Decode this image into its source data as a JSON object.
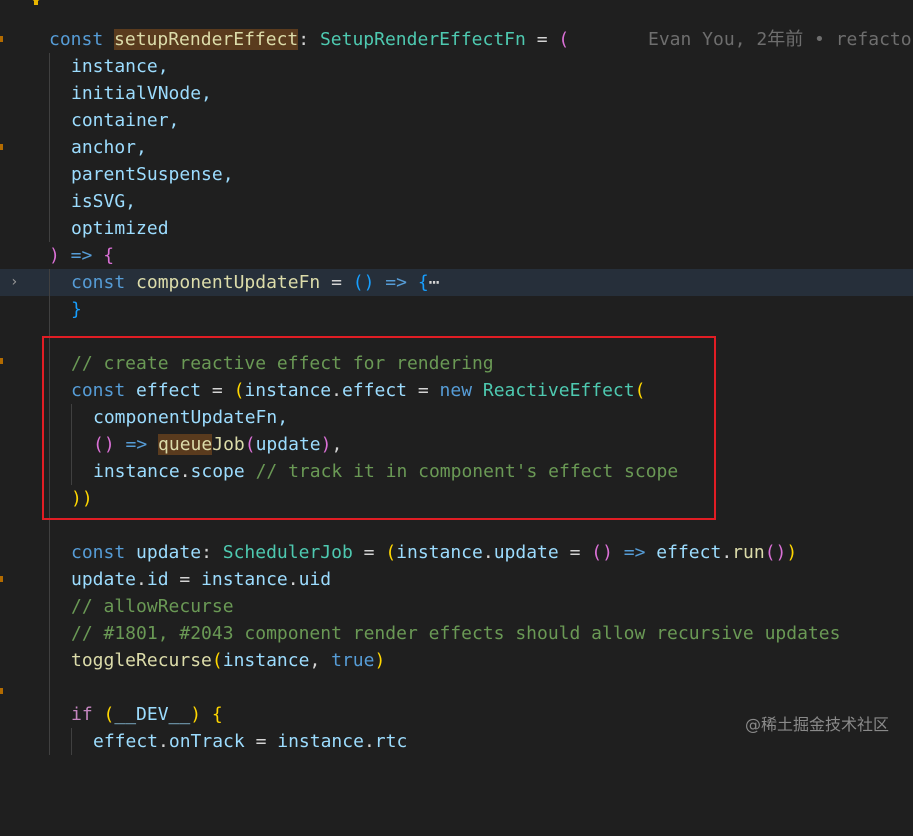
{
  "blame": "Evan You, 2年前 • refacto",
  "watermark": "@稀土掘金技术社区",
  "code": {
    "l1_const": "const",
    "l1_name": "setupRenderEffect",
    "l1_colon": ": ",
    "l1_type": "SetupRenderEffectFn",
    "l1_eq": " = ",
    "l1_paren": "(",
    "p_instance": "instance,",
    "p_initialVNode": "initialVNode,",
    "p_container": "container,",
    "p_anchor": "anchor,",
    "p_parentSuspense": "parentSuspense,",
    "p_isSVG": "isSVG,",
    "p_optimized": "optimized",
    "close_paren": ")",
    "arrow_open": " => ",
    "brace_open": "{",
    "cu_const": "const",
    "cu_name": "componentUpdateFn",
    "cu_eq": " = ",
    "cu_parens": "()",
    "cu_arrow": " => ",
    "cu_brace": "{",
    "cu_ellipsis": "⋯",
    "close_brace": "}",
    "comment_create": "// create reactive effect for rendering",
    "e_const": "const",
    "e_effect": "effect",
    "e_eq": " = ",
    "e_paren": "(",
    "e_instance": "instance",
    "e_dot": ".",
    "e_effect2": "effect",
    "e_eq2": " = ",
    "e_new": "new",
    "e_class": "ReactiveEffect",
    "e_paren2": "(",
    "a_cuf": "componentUpdateFn,",
    "a_parens": "()",
    "a_arrow": " => ",
    "a_queue": "queue",
    "a_job": "Job",
    "a_p": "(",
    "a_update": "update",
    "a_pc": ")",
    "a_comma": ",",
    "s_instance": "instance",
    "s_dot": ".",
    "s_scope": "scope",
    "s_comment": " // track it in component's effect scope",
    "close_pp": "))",
    "u_const": "const",
    "u_update": "update",
    "u_colon": ": ",
    "u_type": "SchedulerJob",
    "u_eq": " = ",
    "u_p": "(",
    "u_instance": "instance",
    "u_dot": ".",
    "u_update2": "update",
    "u_eq2": " = ",
    "u_parens": "()",
    "u_arrow": " => ",
    "u_effect": "effect",
    "u_dot2": ".",
    "u_run": "run",
    "u_runp": "()",
    "u_close": ")",
    "id_update": "update",
    "id_dot": ".",
    "id_id": "id",
    "id_eq": " = ",
    "id_instance": "instance",
    "id_dot2": ".",
    "id_uid": "uid",
    "c_allow": "// allowRecurse",
    "c_issue": "// #1801, #2043 component render effects should allow recursive updates",
    "t_fn": "toggleRecurse",
    "t_p": "(",
    "t_instance": "instance",
    "t_comma": ", ",
    "t_true": "true",
    "t_pc": ")",
    "if_kw": "if",
    "if_sp": " ",
    "if_p": "(",
    "if_dev": "__DEV__",
    "if_pc": ")",
    "if_brace": " {",
    "ot_effect": "effect",
    "ot_dot": ".",
    "ot_onTrack": "onTrack",
    "ot_eq": " = ",
    "ot_instance": "instance",
    "ot_dot2": ".",
    "ot_rtc": "rtc"
  }
}
